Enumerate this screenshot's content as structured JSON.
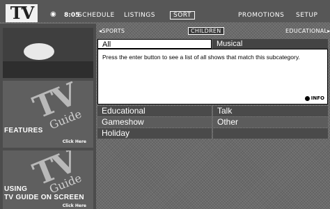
{
  "header": {
    "logo": "TV",
    "time": "8:05",
    "nav": [
      "SCHEDULE",
      "LISTINGS",
      "SORT",
      "PROMOTIONS",
      "SETUP"
    ],
    "active_nav": "SORT"
  },
  "sidebar": {
    "tiles": [
      {
        "title": ""
      },
      {
        "title": "FEATURES",
        "click": "Click Here"
      },
      {
        "title_line1": "USING",
        "title_line2": "TV GUIDE ON SCREEN",
        "click": "Click Here"
      }
    ],
    "art": {
      "tv": "TV",
      "guide": "Guide"
    }
  },
  "subcategory_bar": {
    "prev": "◂SPORTS",
    "current": "CHILDREN",
    "next": "EDUCATIONAL▸"
  },
  "filters": {
    "selected": "All",
    "other": "Musical"
  },
  "message": {
    "text": "Press the enter button to see a list of all shows that match this subcategory.",
    "info": "INFO"
  },
  "categories": [
    {
      "left": "Educational",
      "right": "Talk"
    },
    {
      "left": "Gameshow",
      "right": "Other"
    },
    {
      "left": "Holiday",
      "right": ""
    }
  ]
}
